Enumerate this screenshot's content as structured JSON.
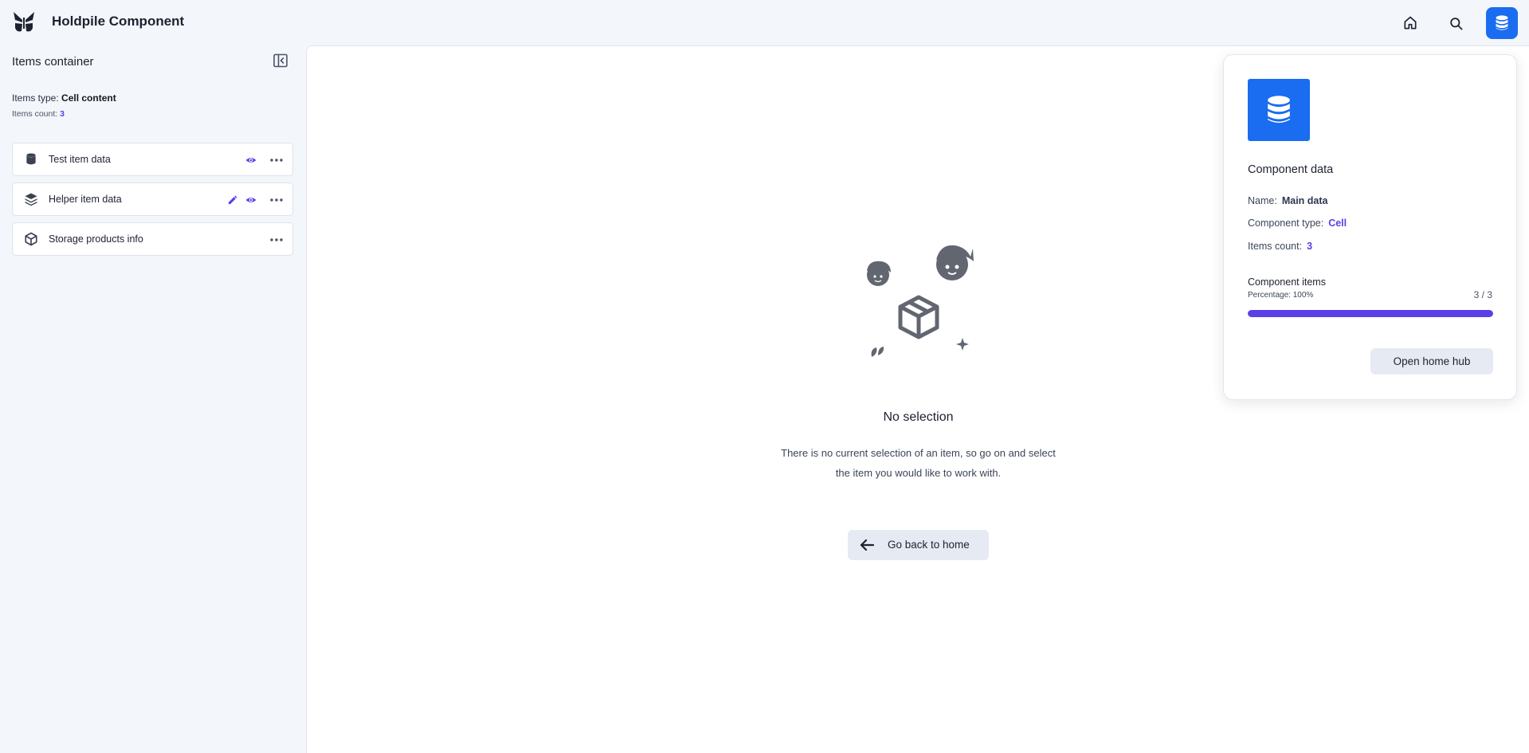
{
  "header": {
    "app_title": "Holdpile Component",
    "icons": [
      "butterfly-logo",
      "home-icon",
      "search-icon",
      "database-icon"
    ],
    "accent": "#1a6cf0"
  },
  "sidebar": {
    "title": "Items container",
    "type_label": "Items type:",
    "type_value": "Cell content",
    "count_label": "Items count:",
    "count_value": "3",
    "items": [
      {
        "label": "Test item data",
        "icon": "database-icon",
        "actions": [
          "eye-icon",
          "more-icon"
        ]
      },
      {
        "label": "Helper item data",
        "icon": "layers-icon",
        "actions": [
          "pencil-icon",
          "eye-icon",
          "more-icon"
        ]
      },
      {
        "label": "Storage products info",
        "icon": "box-icon",
        "actions": [
          "more-icon"
        ]
      }
    ]
  },
  "main": {
    "empty_title": "No selection",
    "empty_desc_line1": "There is no current selection of an item, so go on and select",
    "empty_desc_line2": "the item you would like to work with.",
    "back_button": "Go back to home"
  },
  "card": {
    "title": "Component data",
    "name_label": "Name:",
    "name_value": "Main data",
    "type_label": "Component type:",
    "type_value": "Cell",
    "count_label": "Items count:",
    "count_value": "3",
    "items_title": "Component items",
    "percentage_label": "Percentage:",
    "percentage_value": "100%",
    "fraction": "3 / 3",
    "progress": 1.0,
    "hub_button": "Open home hub",
    "accent": "#5b3ee8"
  }
}
